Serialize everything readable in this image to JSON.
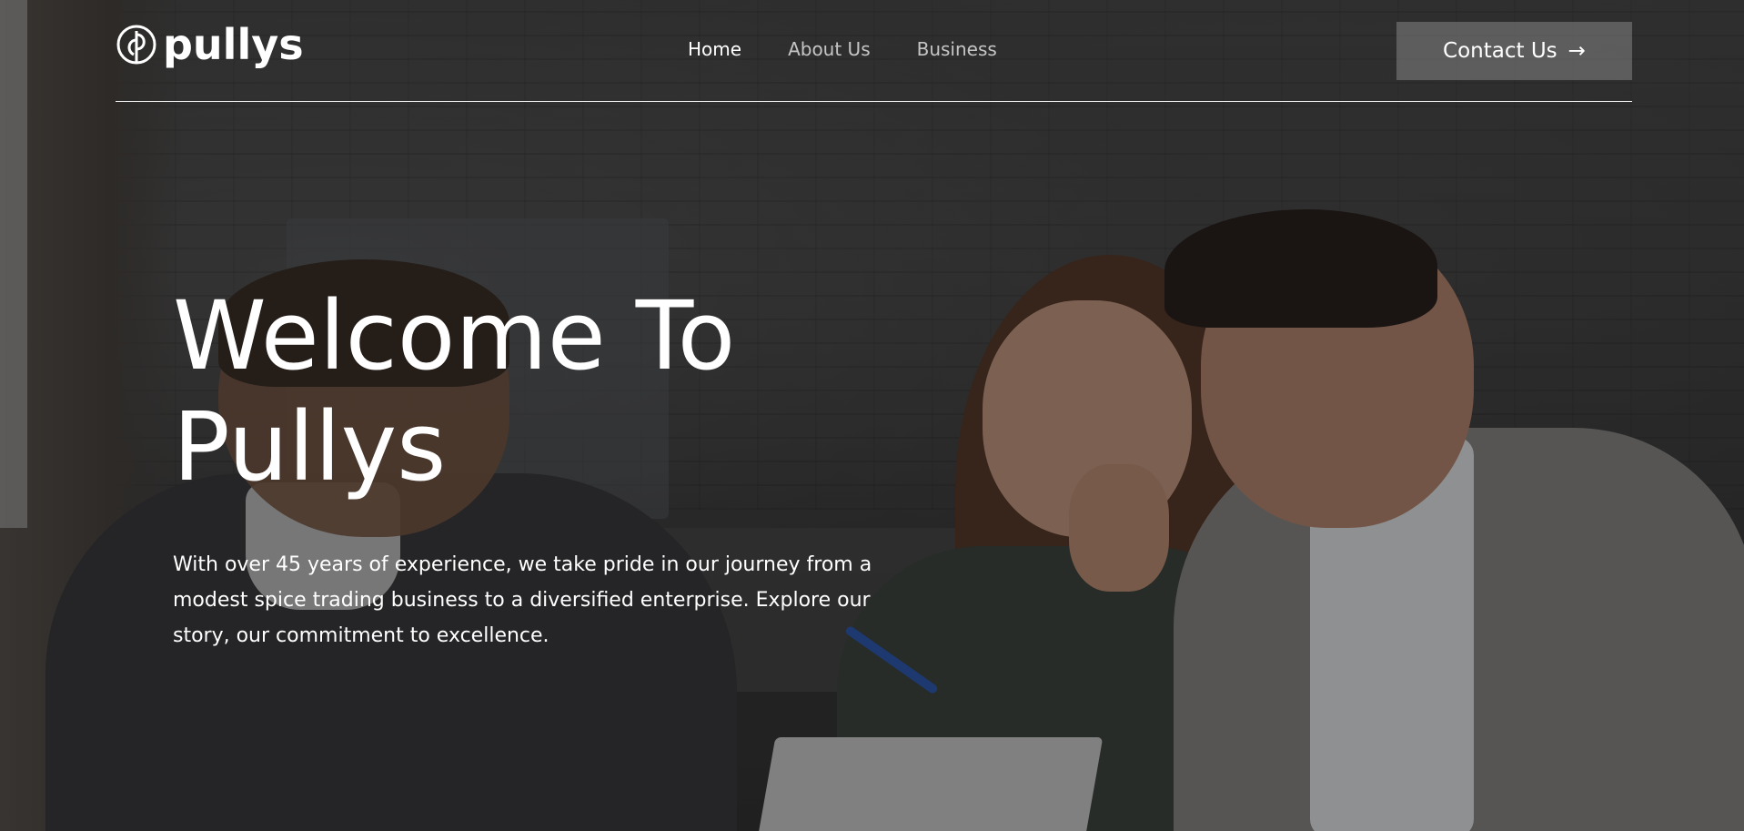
{
  "brand": {
    "name": "pullys",
    "logo_icon": "pullys-logo-icon"
  },
  "nav": {
    "items": [
      {
        "label": "Home",
        "active": true
      },
      {
        "label": "About Us",
        "active": false
      },
      {
        "label": "Business",
        "active": false
      }
    ]
  },
  "header": {
    "contact_label": "Contact Us",
    "contact_icon": "→"
  },
  "hero": {
    "title_line1": "Welcome To",
    "title_line2": "Pullys",
    "description": "With over 45 years of experience, we take pride in our journey from a modest spice trading business to a diversified enterprise. Explore our story, our commitment to excellence."
  }
}
